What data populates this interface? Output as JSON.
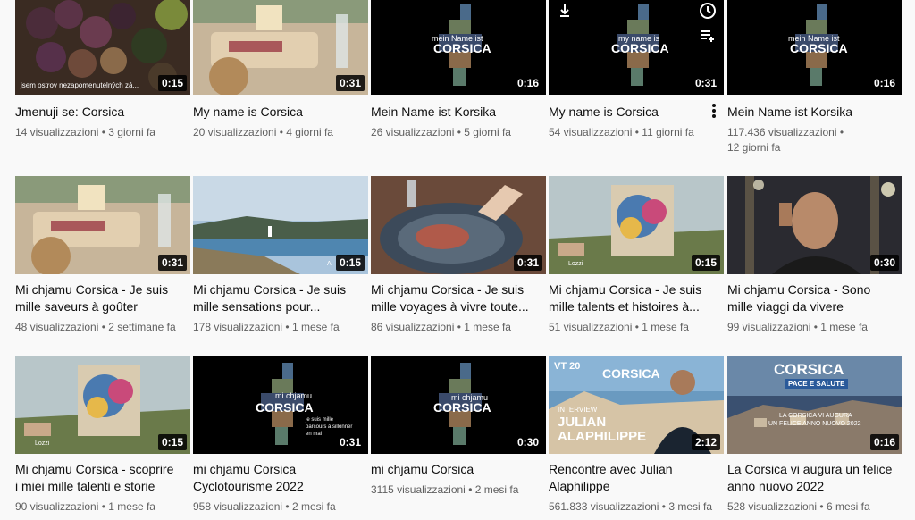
{
  "videos": [
    {
      "title_line1": "Jmenuji se: Corsica",
      "title_line2": "",
      "views": "14 visualizzazioni",
      "age": "3 giorni fa",
      "duration": "0:15",
      "caption": "jsem ostrov nezapomenutelných zá..."
    },
    {
      "title_line1": "My name is Corsica",
      "title_line2": "",
      "views": "20 visualizzazioni",
      "age": "4 giorni fa",
      "duration": "0:31"
    },
    {
      "title_line1": "Mein Name ist Korsika",
      "title_line2": "",
      "views": "26 visualizzazioni",
      "age": "5 giorni fa",
      "duration": "0:16",
      "logo_top": "mein Name ist",
      "logo_main": "CORSICA"
    },
    {
      "title_line1": "My name is Corsica",
      "title_line2": "",
      "views": "54 visualizzazioni",
      "age": "11 giorni fa",
      "duration": "0:31",
      "logo_top": "my name is",
      "logo_main": "CORSICA"
    },
    {
      "title_line1": "Mein Name ist Korsika",
      "title_line2": "",
      "views": "117.436 visualizzazioni",
      "age": "12 giorni fa",
      "duration": "0:16",
      "logo_top": "mein Name ist",
      "logo_main": "CORSICA"
    },
    {
      "title_line1": "Mi chjamu Corsica - Je suis",
      "title_line2": "mille saveurs à goûter",
      "views": "48 visualizzazioni",
      "age": "2 settimane fa",
      "duration": "0:31"
    },
    {
      "title_line1": "Mi chjamu Corsica - Je suis",
      "title_line2": "mille sensations pour...",
      "views": "178 visualizzazioni",
      "age": "1 mese fa",
      "duration": "0:15",
      "location": "A"
    },
    {
      "title_line1": "Mi chjamu Corsica - Je suis",
      "title_line2": "mille voyages à vivre toute...",
      "views": "86 visualizzazioni",
      "age": "1 mese fa",
      "duration": "0:31"
    },
    {
      "title_line1": "Mi chjamu Corsica - Je suis",
      "title_line2": "mille talents et histoires à...",
      "views": "51 visualizzazioni",
      "age": "1 mese fa",
      "duration": "0:15",
      "location": "Lozzi"
    },
    {
      "title_line1": "Mi chjamu Corsica - Sono",
      "title_line2": "mille viaggi da vivere",
      "views": "99 visualizzazioni",
      "age": "1 mese fa",
      "duration": "0:30"
    },
    {
      "title_line1": "Mi chjamu Corsica - scoprire",
      "title_line2": "i miei mille talenti e storie",
      "views": "90 visualizzazioni",
      "age": "1 mese fa",
      "duration": "0:15",
      "location": "Lozzi"
    },
    {
      "title_line1": "mi chjamu Corsica",
      "title_line2": "Cyclotourisme 2022",
      "views": "958 visualizzazioni",
      "age": "2 mesi fa",
      "duration": "0:31",
      "logo_top": "mi chjamu",
      "logo_main": "CORSICA",
      "side_text": "je suis mille parcours à sillonner en mai"
    },
    {
      "title_line1": "mi chjamu Corsica",
      "title_line2": "",
      "views": "3115 visualizzazioni",
      "age": "2 mesi fa",
      "duration": "0:30",
      "logo_top": "mi chjamu",
      "logo_main": "CORSICA"
    },
    {
      "title_line1": "Rencontre avec Julian",
      "title_line2": "Alaphilippe",
      "views": "561.833 visualizzazioni",
      "age": "3 mesi fa",
      "duration": "2:12",
      "badge": "VT 20",
      "logo_main": "CORSICA",
      "interview_label": "INTERVIEW",
      "person_first": "JULIAN",
      "person_last": "ALAPHILIPPE"
    },
    {
      "title_line1": "La Corsica vi augura un felice",
      "title_line2": "anno nuovo 2022",
      "views": "528 visualizzazioni",
      "age": "6 mesi fa",
      "duration": "0:16",
      "logo_main": "CORSICA",
      "subline": "PACE E SALUTE",
      "greet1": "LA CORSICA VI AUGURA",
      "greet2": "UN FELICE ANNO NUOVO 2022"
    }
  ],
  "separator": "•",
  "icons": {
    "watch_later": "clock-icon",
    "add_queue": "queue-icon",
    "download": "download-icon",
    "menu": "more-vert-icon"
  },
  "colors": {
    "duration_bg": "#000000",
    "meta": "#606060",
    "title": "#0f0f0f",
    "page_bg": "#f9f9f9"
  }
}
